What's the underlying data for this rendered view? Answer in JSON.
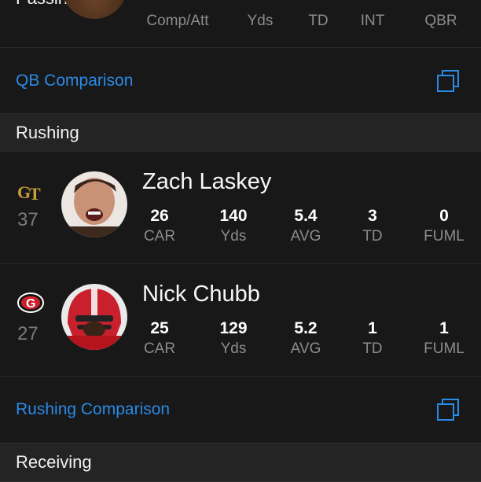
{
  "passing": {
    "title": "Passing",
    "headers": [
      "Comp/Att",
      "Yds",
      "TD",
      "INT",
      "QBR"
    ]
  },
  "qb_comparison": {
    "label": "QB Comparison",
    "icon": "copy-icon"
  },
  "rushing": {
    "title": "Rushing",
    "players": [
      {
        "name": "Zach Laskey",
        "number": "37",
        "team_logo": "georgia-tech-gt-logo",
        "stats": [
          {
            "value": "26",
            "label": "CAR"
          },
          {
            "value": "140",
            "label": "Yds"
          },
          {
            "value": "5.4",
            "label": "AVG"
          },
          {
            "value": "3",
            "label": "TD"
          },
          {
            "value": "0",
            "label": "FUML"
          }
        ]
      },
      {
        "name": "Nick Chubb",
        "number": "27",
        "team_logo": "georgia-g-logo",
        "stats": [
          {
            "value": "25",
            "label": "CAR"
          },
          {
            "value": "129",
            "label": "Yds"
          },
          {
            "value": "5.2",
            "label": "AVG"
          },
          {
            "value": "1",
            "label": "TD"
          },
          {
            "value": "1",
            "label": "FUML"
          }
        ]
      }
    ]
  },
  "rushing_comparison": {
    "label": "Rushing Comparison",
    "icon": "copy-icon"
  },
  "receiving": {
    "title": "Receiving"
  },
  "colors": {
    "background": "#161616",
    "section_header": "#242424",
    "link": "#2a8ae6",
    "gt_gold": "#c9a03a",
    "uga_red": "#cc1f2b"
  }
}
